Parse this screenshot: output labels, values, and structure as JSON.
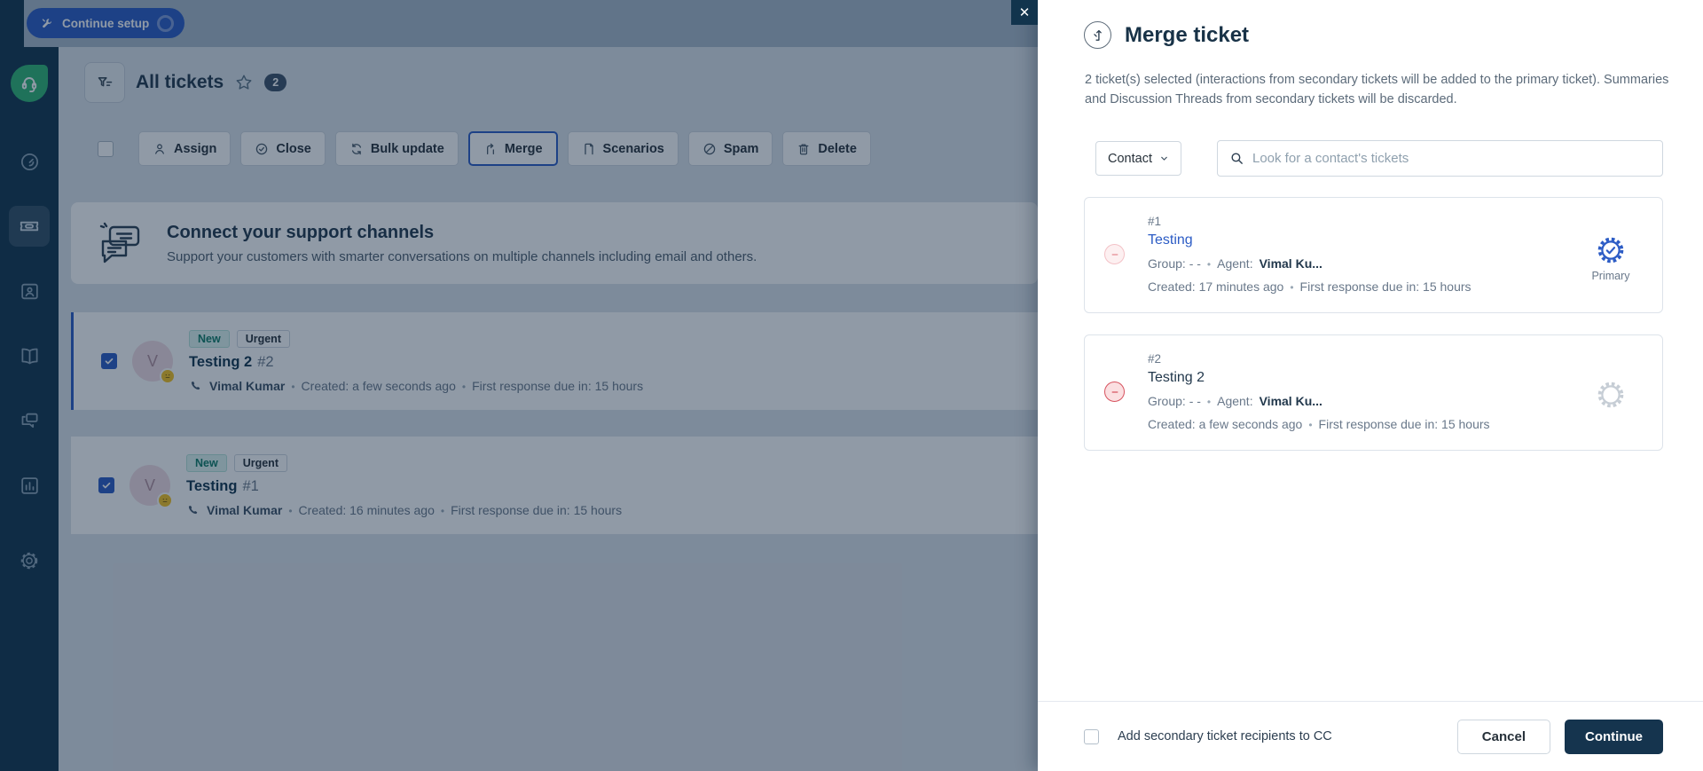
{
  "topbar": {
    "continue_setup_label": "Continue setup"
  },
  "list_header": {
    "title": "All tickets",
    "count": "2"
  },
  "toolbar": {
    "buttons": [
      {
        "label": "Assign",
        "icon": "person-icon"
      },
      {
        "label": "Close",
        "icon": "check-circle-icon"
      },
      {
        "label": "Bulk update",
        "icon": "refresh-icon"
      },
      {
        "label": "Merge",
        "icon": "merge-icon",
        "active": true
      },
      {
        "label": "Scenarios",
        "icon": "scenario-icon"
      },
      {
        "label": "Spam",
        "icon": "ban-icon"
      },
      {
        "label": "Delete",
        "icon": "trash-icon"
      }
    ]
  },
  "banner": {
    "title": "Connect your support channels",
    "subtitle": "Support your customers with smarter conversations on multiple channels including email and others."
  },
  "tickets": [
    {
      "avatar_initial": "V",
      "badges": [
        "New",
        "Urgent"
      ],
      "title": "Testing 2",
      "ticket_id": "#2",
      "requester": "Vimal Kumar",
      "created": "Created: a few seconds ago",
      "due": "First response due in: 15 hours"
    },
    {
      "avatar_initial": "V",
      "badges": [
        "New",
        "Urgent"
      ],
      "title": "Testing",
      "ticket_id": "#1",
      "requester": "Vimal Kumar",
      "created": "Created: 16 minutes ago",
      "due": "First response due in: 15 hours"
    }
  ],
  "merge_panel": {
    "title": "Merge ticket",
    "description": "2 ticket(s) selected (interactions from secondary tickets will be added to the primary ticket). Summaries and Discussion Threads from secondary tickets will be discarded.",
    "contact_dropdown_label": "Contact",
    "search_placeholder": "Look for a contact's tickets",
    "cards": [
      {
        "id": "#1",
        "title": "Testing",
        "group_label": "Group: - -",
        "agent_label": "Agent:",
        "agent": "Vimal Ku...",
        "created": "Created: 17 minutes ago",
        "due": "First response due in: 15 hours",
        "primary_label": "Primary"
      },
      {
        "id": "#2",
        "title": "Testing 2",
        "group_label": "Group: - -",
        "agent_label": "Agent:",
        "agent": "Vimal Ku...",
        "created": "Created: a few seconds ago",
        "due": "First response due in: 15 hours"
      }
    ],
    "footer": {
      "cc_checkbox_label": "Add secondary ticket recipients to CC",
      "cancel_label": "Cancel",
      "continue_label": "Continue"
    }
  },
  "colors": {
    "accent_blue": "#2c5cc5",
    "dark_navy": "#12344d",
    "brand_green": "#2fb573",
    "danger": "#d7535f",
    "badge_new_text": "#0e7c66"
  }
}
